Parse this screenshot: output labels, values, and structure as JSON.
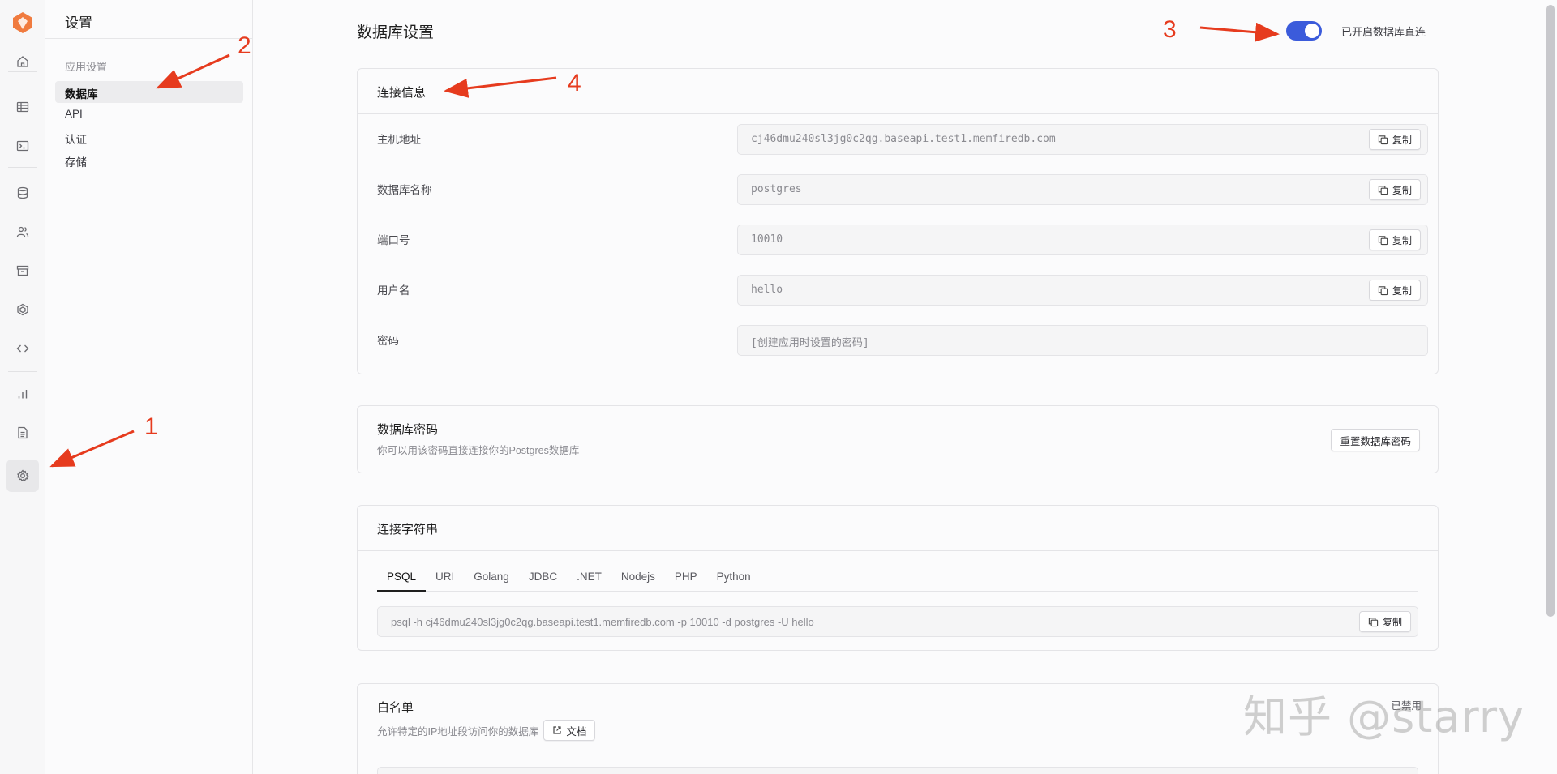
{
  "sidebar": {
    "title": "设置",
    "group_label": "应用设置",
    "items": [
      {
        "label": "数据库"
      },
      {
        "label": "API"
      },
      {
        "label": "认证"
      },
      {
        "label": "存储"
      }
    ]
  },
  "rail_icons": [
    "home-icon",
    "table-icon",
    "terminal-icon",
    "database-icon",
    "users-icon",
    "archive-icon",
    "functions-icon",
    "code-icon",
    "chart-icon",
    "file-icon",
    "gear-icon"
  ],
  "page": {
    "title": "数据库设置",
    "toggle_label": "已开启数据库直连",
    "toggle_on": true
  },
  "connection_info": {
    "title": "连接信息",
    "copy_label": "复制",
    "fields": [
      {
        "label": "主机地址",
        "value": "cj46dmu240sl3jg0c2qg.baseapi.test1.memfiredb.com"
      },
      {
        "label": "数据库名称",
        "value": "postgres"
      },
      {
        "label": "端口号",
        "value": "10010"
      },
      {
        "label": "用户名",
        "value": "hello"
      },
      {
        "label": "密码",
        "value": "[创建应用时设置的密码]"
      }
    ]
  },
  "db_password": {
    "title": "数据库密码",
    "description": "你可以用该密码直接连接你的Postgres数据库",
    "reset_label": "重置数据库密码"
  },
  "conn_string": {
    "title": "连接字符串",
    "tabs": [
      "PSQL",
      "URI",
      "Golang",
      "JDBC",
      ".NET",
      "Nodejs",
      "PHP",
      "Python"
    ],
    "active_tab": "PSQL",
    "value": "psql -h cj46dmu240sl3jg0c2qg.baseapi.test1.memfiredb.com -p 10010 -d postgres -U hello",
    "copy_label": "复制"
  },
  "whitelist": {
    "title": "白名单",
    "description": "允许特定的IP地址段访问你的数据库",
    "doc_label": "文档",
    "right_label": "已禁用"
  },
  "annotations": [
    "1",
    "2",
    "3",
    "4"
  ],
  "watermark": "知乎 @starry",
  "colors": {
    "accent": "#3b5bdb",
    "annotation": "#e63b1e"
  }
}
